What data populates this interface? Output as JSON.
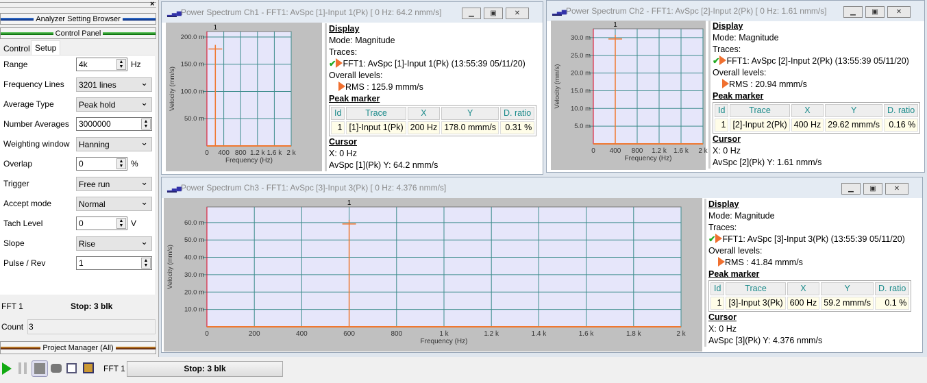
{
  "left_panel": {
    "browser_title": "Analyzer Setting Browser",
    "control_title": "Control Panel",
    "tabs": [
      "Control",
      "Setup"
    ],
    "active_tab": "Setup",
    "fields": [
      {
        "label": "Range",
        "value": "4k",
        "type": "spin",
        "unit": "Hz"
      },
      {
        "label": "Frequency Lines",
        "value": "3201 lines",
        "type": "select"
      },
      {
        "label": "Average Type",
        "value": "Peak hold",
        "type": "select"
      },
      {
        "label": "Number Averages",
        "value": "3000000",
        "type": "spin"
      },
      {
        "label": "Weighting window",
        "value": "Hanning",
        "type": "select"
      },
      {
        "label": "Overlap",
        "value": "0",
        "type": "spin",
        "unit": "%"
      },
      {
        "label": "Trigger",
        "value": "Free run",
        "type": "select"
      },
      {
        "label": "Accept mode",
        "value": "Normal",
        "type": "select"
      },
      {
        "label": "Tach Level",
        "value": "0",
        "type": "spin",
        "unit": "V"
      },
      {
        "label": "Slope",
        "value": "Rise",
        "type": "select"
      },
      {
        "label": "Pulse / Rev",
        "value": "1",
        "type": "spin"
      }
    ],
    "status_name": "FFT 1",
    "status_value": "Stop: 3 blk",
    "count_label": "Count",
    "count_value": "3",
    "project_title": "Project Manager (All)"
  },
  "windows": [
    {
      "title": "Power Spectrum Ch1 - FFT1: AvSpc [1]-Input 1(Pk) [ 0 Hz:  64.2 nmm/s]",
      "display": "Display",
      "mode": "Mode: Magnitude",
      "traces_label": "Traces:",
      "trace": "FFT1: AvSpc [1]-Input 1(Pk) (13:55:39 05/11/20)",
      "overall_label": "Overall levels:",
      "rms": "RMS : 125.9 mmm/s",
      "peak_label": "Peak marker",
      "peak_headers": [
        "Id",
        "Trace",
        "X",
        "Y",
        "D. ratio"
      ],
      "peak_row": [
        "1",
        "[1]-Input 1(Pk)",
        "200 Hz",
        "178.0 mmm/s",
        "0.31 %"
      ],
      "cursor_label": "Cursor",
      "cursor_x": "X: 0 Hz",
      "cursor_y": "AvSpc [1](Pk) Y: 64.2 nmm/s"
    },
    {
      "title": "Power Spectrum Ch2 - FFT1: AvSpc [2]-Input 2(Pk) [ 0 Hz:  1.61 nmm/s]",
      "display": "Display",
      "mode": "Mode: Magnitude",
      "traces_label": "Traces:",
      "trace": "FFT1: AvSpc [2]-Input 2(Pk) (13:55:39 05/11/20)",
      "overall_label": "Overall levels:",
      "rms": "RMS : 20.94 mmm/s",
      "peak_label": "Peak marker",
      "peak_headers": [
        "Id",
        "Trace",
        "X",
        "Y",
        "D. ratio"
      ],
      "peak_row": [
        "1",
        "[2]-Input 2(Pk)",
        "400 Hz",
        "29.62 mmm/s",
        "0.16 %"
      ],
      "cursor_label": "Cursor",
      "cursor_x": "X: 0 Hz",
      "cursor_y": "AvSpc [2](Pk) Y: 1.61 nmm/s"
    },
    {
      "title": "Power Spectrum Ch3 - FFT1: AvSpc [3]-Input 3(Pk) [ 0 Hz:  4.376 nmm/s]",
      "display": "Display",
      "mode": "Mode: Magnitude",
      "traces_label": "Traces:",
      "trace": "FFT1: AvSpc [3]-Input 3(Pk) (13:55:39 05/11/20)",
      "overall_label": "Overall levels:",
      "rms": "RMS : 41.84 mmm/s",
      "peak_label": "Peak marker",
      "peak_headers": [
        "Id",
        "Trace",
        "X",
        "Y",
        "D. ratio"
      ],
      "peak_row": [
        "1",
        "[3]-Input 3(Pk)",
        "600 Hz",
        "59.2 mmm/s",
        "0.1 %"
      ],
      "cursor_label": "Cursor",
      "cursor_x": "X: 0 Hz",
      "cursor_y": "AvSpc [3](Pk) Y: 4.376 nmm/s"
    }
  ],
  "chart_data": [
    {
      "type": "line",
      "xlabel": "Frequency (Hz)",
      "ylabel": "Velocity (mm/s)",
      "xlim": [
        0,
        2000
      ],
      "ylim": [
        0,
        210
      ],
      "xticks": [
        0,
        400,
        800,
        1200,
        1600,
        2000
      ],
      "xtick_labels": [
        "0",
        "400",
        "800",
        "1.2 k",
        "1.6 k",
        "2 k"
      ],
      "yticks": [
        50,
        100,
        150,
        200
      ],
      "ytick_labels": [
        "50.0 m",
        "100.0 m",
        "150.0 m",
        "200.0 m"
      ],
      "peaks": [
        {
          "x": 200,
          "y": 178.0
        }
      ],
      "marker_label": "1",
      "grid": true,
      "color": "#f07830"
    },
    {
      "type": "line",
      "xlabel": "Frequency (Hz)",
      "ylabel": "Velocity (mm/s)",
      "xlim": [
        0,
        2000
      ],
      "ylim": [
        0,
        32.5
      ],
      "xticks": [
        0,
        400,
        800,
        1200,
        1600,
        2000
      ],
      "xtick_labels": [
        "0",
        "400",
        "800",
        "1.2 k",
        "1.6 k",
        "2 k"
      ],
      "yticks": [
        5,
        10,
        15,
        20,
        25,
        30
      ],
      "ytick_labels": [
        "5.0 m",
        "10.0 m",
        "15.0 m",
        "20.0 m",
        "25.0 m",
        "30.0 m"
      ],
      "peaks": [
        {
          "x": 400,
          "y": 29.62
        }
      ],
      "marker_label": "1",
      "grid": true,
      "color": "#f07830"
    },
    {
      "type": "line",
      "xlabel": "Frequency (Hz)",
      "ylabel": "Velocity (mm/s)",
      "xlim": [
        0,
        2000
      ],
      "ylim": [
        0,
        69
      ],
      "xticks": [
        0,
        200,
        400,
        600,
        800,
        1000,
        1200,
        1400,
        1600,
        1800,
        2000
      ],
      "xtick_labels": [
        "0",
        "200",
        "400",
        "600",
        "800",
        "1 k",
        "1.2 k",
        "1.4 k",
        "1.6 k",
        "1.8 k",
        "2 k"
      ],
      "yticks": [
        10,
        20,
        30,
        40,
        50,
        60
      ],
      "ytick_labels": [
        "10.0 m",
        "20.0 m",
        "30.0 m",
        "40.0 m",
        "50.0 m",
        "60.0 m"
      ],
      "peaks": [
        {
          "x": 600,
          "y": 59.2
        }
      ],
      "marker_label": "1",
      "grid": true,
      "color": "#f07830"
    }
  ],
  "toolbar": {
    "icons": [
      "play-icon",
      "pause-icon",
      "stop-icon",
      "record-icon",
      "window-icon",
      "save-icon"
    ],
    "fft_label": "FFT 1",
    "status": "Stop: 3 blk"
  }
}
